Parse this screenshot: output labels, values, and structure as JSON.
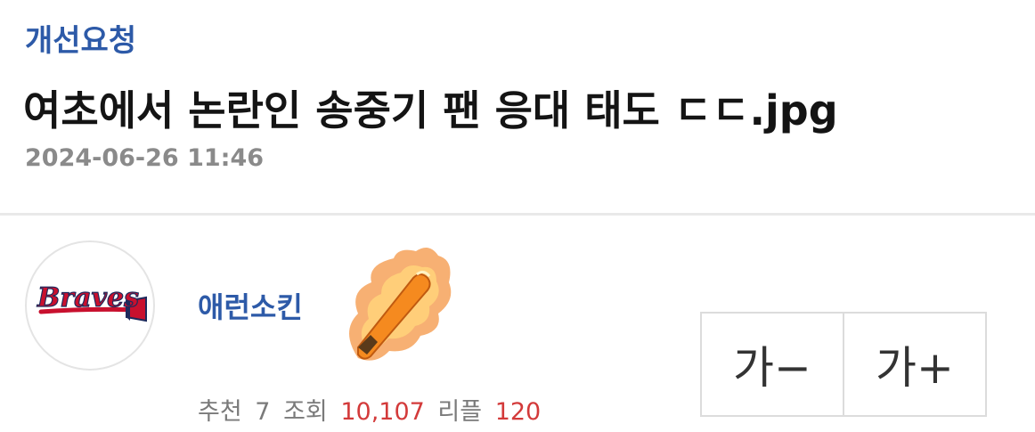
{
  "post": {
    "category": "개선요청",
    "title": "여초에서 논란인 송중기 팬 응대 태도 ㄷㄷ.jpg",
    "timestamp": "2024-06-26 11:46"
  },
  "author": {
    "name": "애런소킨",
    "avatar_icon": "braves-logo-icon",
    "avatar_text": "Braves",
    "rank_icon": "flaming-torch-icon"
  },
  "stats": {
    "recommend_label": "추천",
    "recommend_value": "7",
    "views_label": "조회",
    "views_value": "10,107",
    "replies_label": "리플",
    "replies_value": "120"
  },
  "font_controls": {
    "decrease_label": "가−",
    "increase_label": "가+"
  },
  "colors": {
    "accent": "#2d5aa8",
    "highlight": "#d33a3a",
    "muted": "#8a8a8a"
  }
}
